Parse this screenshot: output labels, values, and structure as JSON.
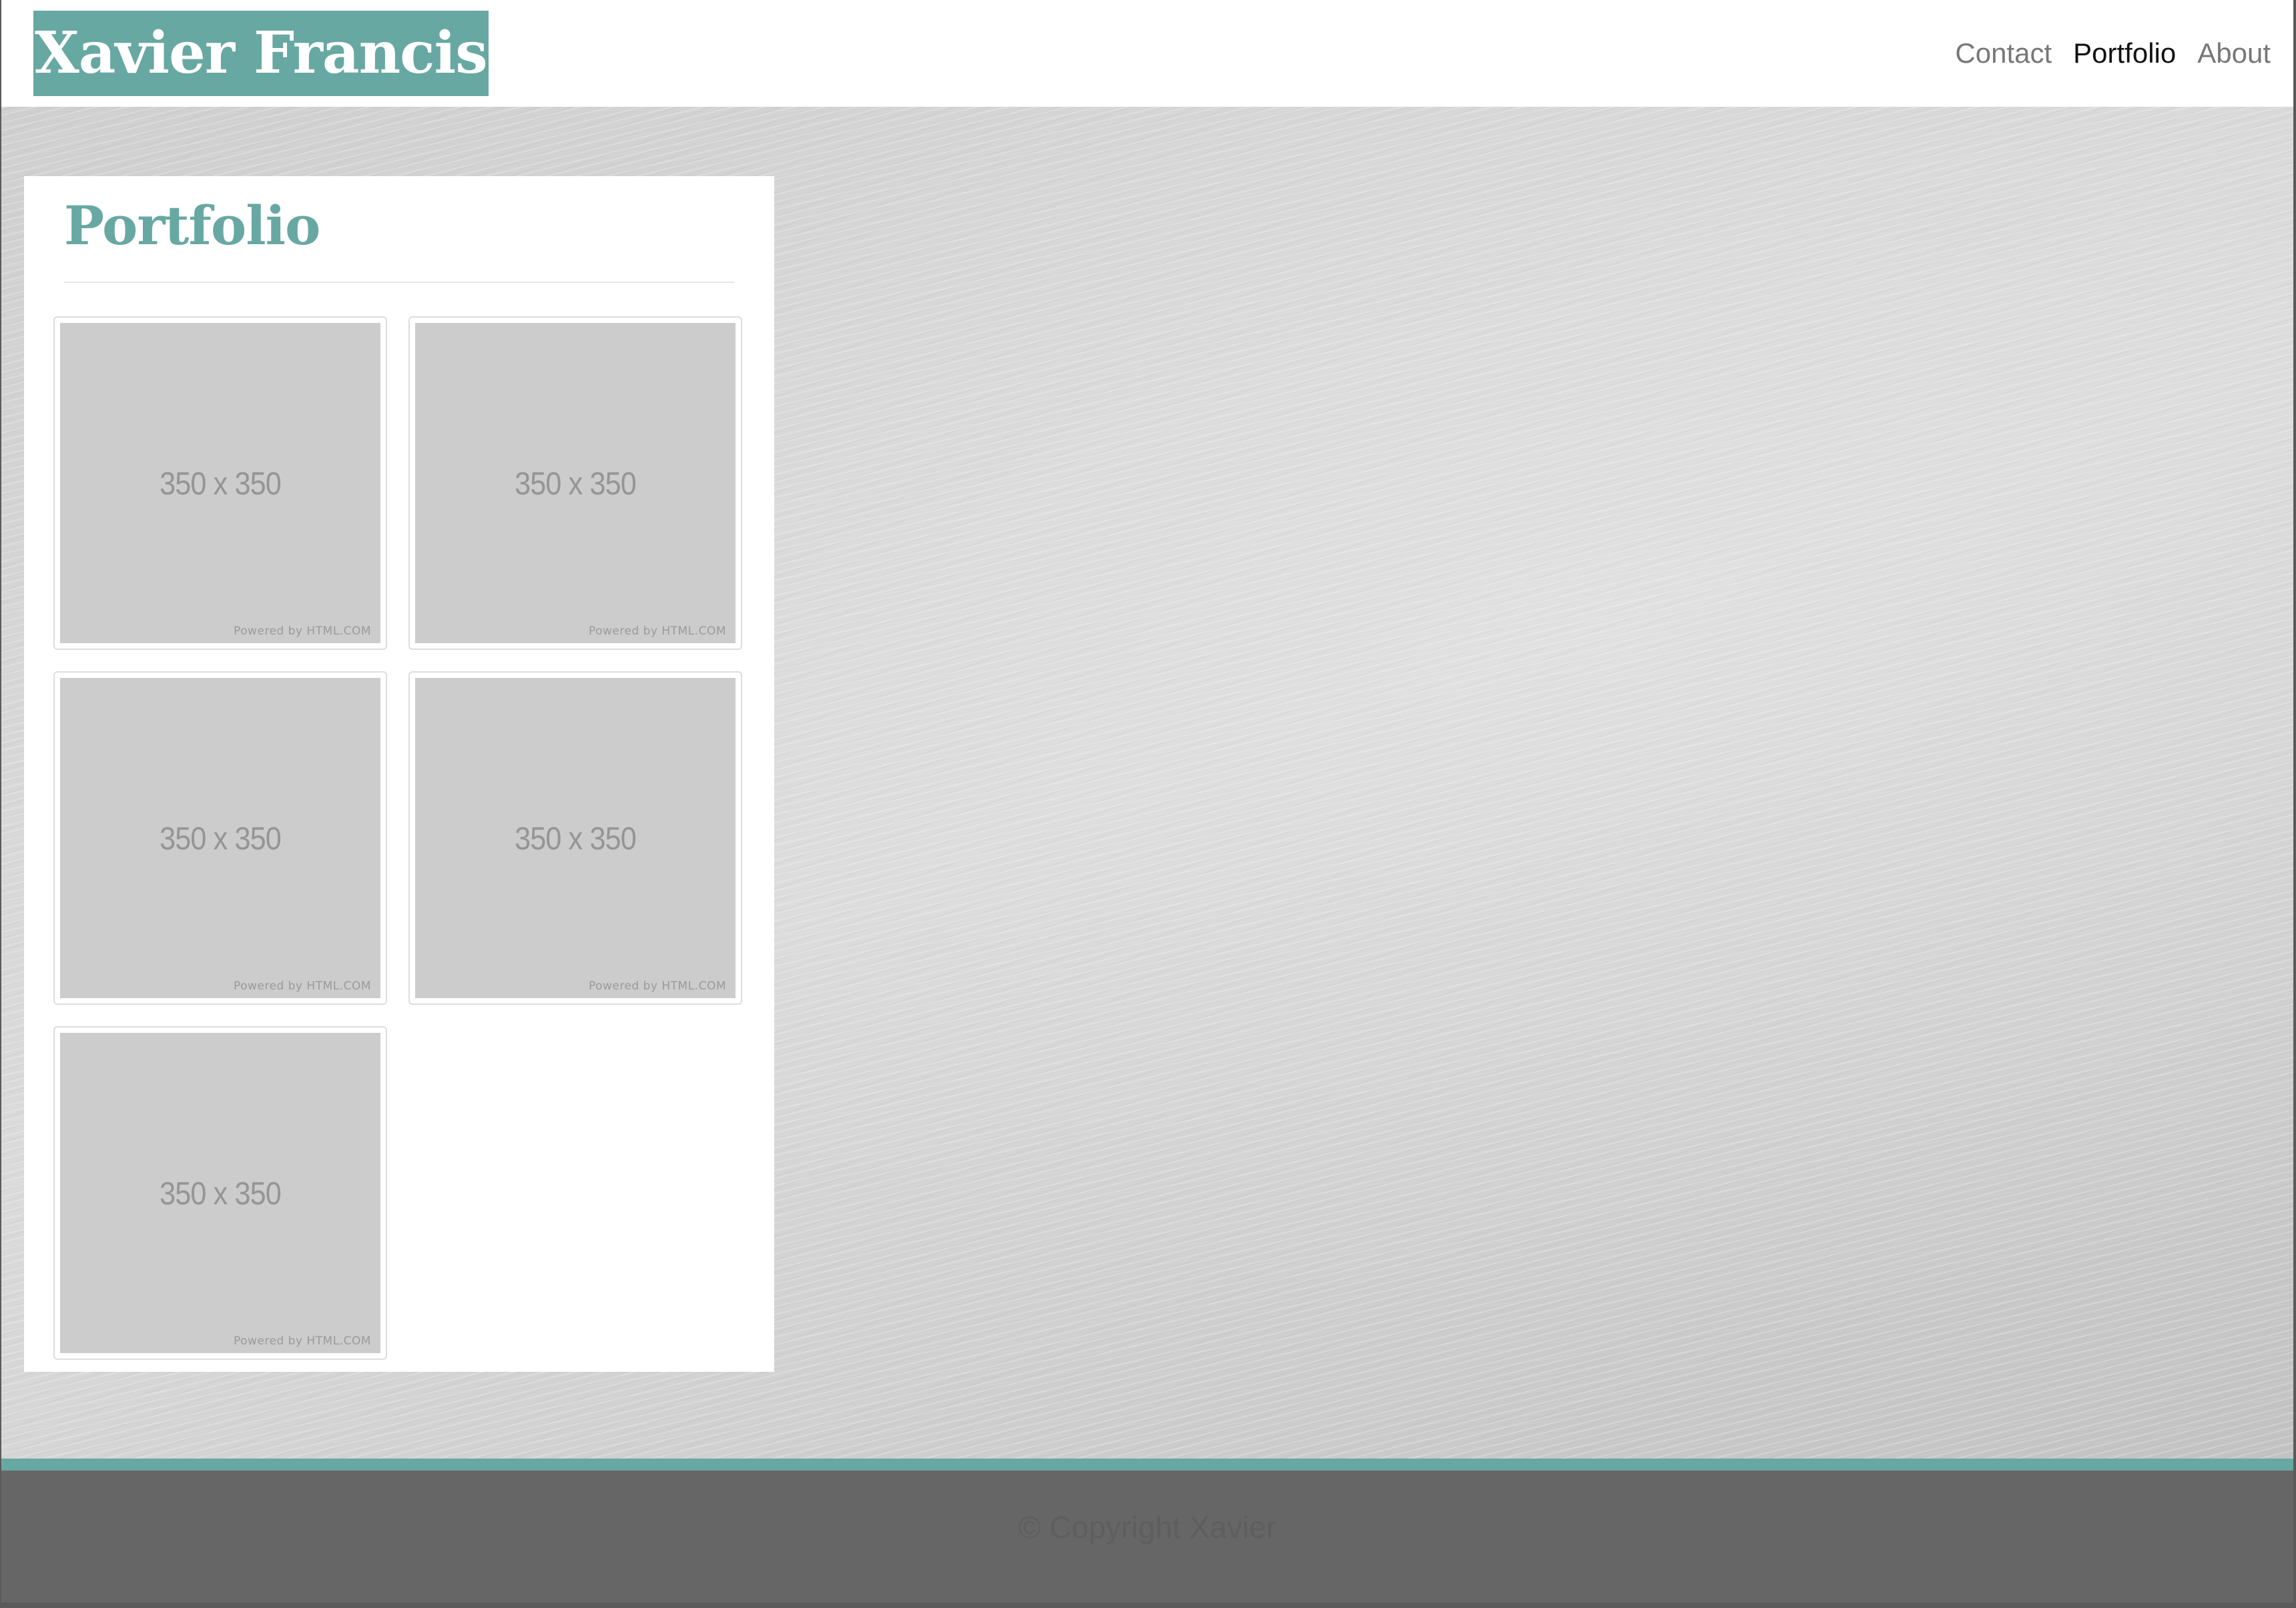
{
  "header": {
    "brand": "Xavier Francis",
    "nav": [
      {
        "label": "Contact",
        "active": false
      },
      {
        "label": "Portfolio",
        "active": true
      },
      {
        "label": "About",
        "active": false
      }
    ]
  },
  "portfolio": {
    "title": "Portfolio",
    "items": [
      {
        "size_label": "350 x 350",
        "powered_by": "Powered by HTML.COM"
      },
      {
        "size_label": "350 x 350",
        "powered_by": "Powered by HTML.COM"
      },
      {
        "size_label": "350 x 350",
        "powered_by": "Powered by HTML.COM"
      },
      {
        "size_label": "350 x 350",
        "powered_by": "Powered by HTML.COM"
      },
      {
        "size_label": "350 x 350",
        "powered_by": "Powered by HTML.COM"
      }
    ]
  },
  "footer": {
    "copyright": "© Copyright Xavier"
  },
  "colors": {
    "accent": "#68a8a3",
    "footer_bg": "#666666",
    "placeholder_bg": "#cccccc"
  }
}
